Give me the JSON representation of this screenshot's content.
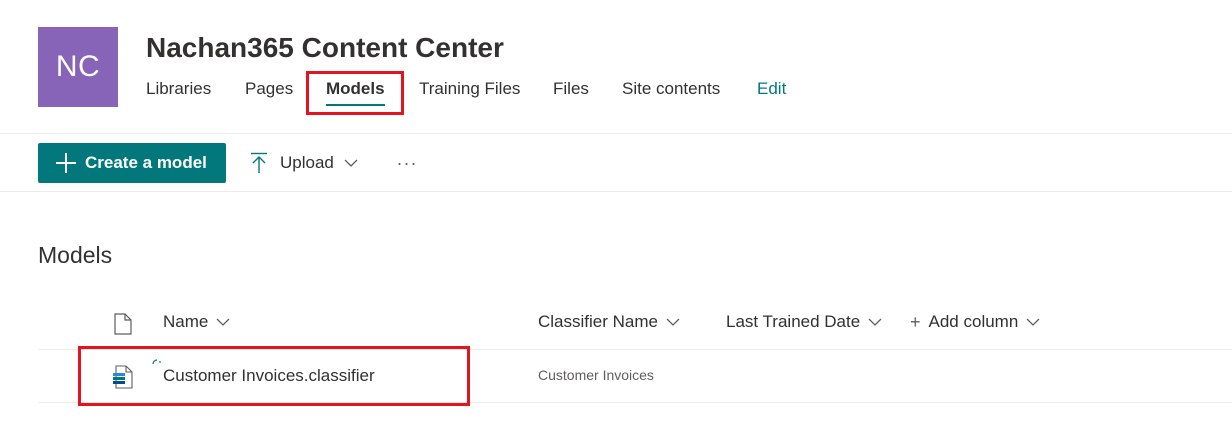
{
  "site": {
    "logo_initials": "NC",
    "logo_color": "#8764b8",
    "title": "Nachan365 Content Center",
    "nav": [
      {
        "label": "Libraries"
      },
      {
        "label": "Pages"
      },
      {
        "label": "Models",
        "selected": true
      },
      {
        "label": "Training Files"
      },
      {
        "label": "Files"
      },
      {
        "label": "Site contents"
      },
      {
        "label": "Edit"
      }
    ]
  },
  "command_bar": {
    "create_label": "Create a model",
    "upload_label": "Upload",
    "more_label": "···"
  },
  "section": {
    "title": "Models"
  },
  "list": {
    "columns": {
      "name": "Name",
      "classifier_name": "Classifier Name",
      "last_trained_date": "Last Trained Date",
      "add_column": "Add column"
    },
    "rows": [
      {
        "name": "Customer Invoices.classifier",
        "classifier_name": "Customer Invoices",
        "last_trained_date": ""
      }
    ]
  },
  "colors": {
    "accent": "#03787c",
    "highlight": "#e3141f"
  }
}
